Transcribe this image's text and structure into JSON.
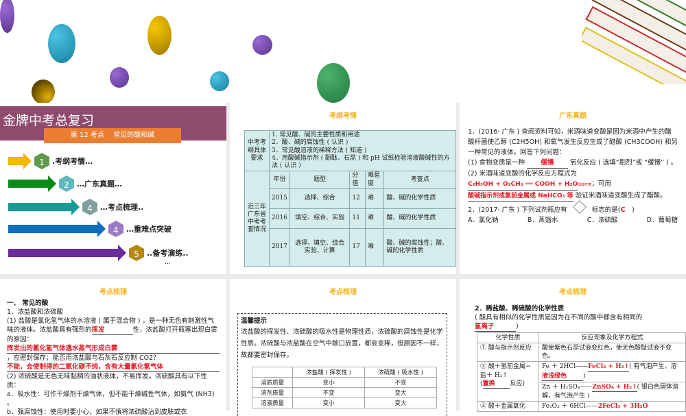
{
  "colors": {
    "banner": "#8f4b6d",
    "ribbon": "#ed7d31",
    "accent_title": "#f2b41c",
    "answer_red": "#e0202a",
    "table_bg": "#d4ecec"
  },
  "slide1": {
    "title": "金牌中考总复习",
    "ribbon": "第 12 考点　 常见的酸和碱",
    "items": [
      {
        "num": "1",
        "label": ".考纲考情…",
        "color": "#f5b800",
        "cube": "#5e9a4a"
      },
      {
        "num": "2",
        "label": "…广东真题…",
        "color": "#0a8a1a",
        "cube": "#5fb8c0"
      },
      {
        "num": "4",
        "label": "…考点梳理..",
        "color": "#139c96",
        "cube": "#7f9e9e"
      },
      {
        "num": "4",
        "label": "…重难点突破",
        "color": "#0f6fbf",
        "cube": "#9b7cc4"
      },
      {
        "num": "5",
        "label": "..备考演练..",
        "color": "#6a2c9a",
        "cube": "#b58a10"
      }
    ],
    "dots": [
      "…",
      "…",
      "…",
      "………",
      "…"
    ]
  },
  "slide2": {
    "heading": "考纲考情",
    "req_label": "中考考纲具体要求",
    "requirements": [
      "1. 常见酸、碱的主要性质和用途",
      "2．酸、碱的腐蚀性 ( 认识 )",
      "3．常见酸溶液的稀释方法 ( 知道 )",
      "4．用酸碱指示剂 ( 酚酞、石蕊 ) 和 pH 试纸检验溶液酸碱性的方法 ( 认识 )"
    ],
    "history_label": "近三年广东省中考考查情况",
    "headers": [
      "年份",
      "题型",
      "分值",
      "难易度",
      "考查点"
    ],
    "rows": [
      [
        "2015",
        "选择、综合",
        "12",
        "难",
        "酸、碱的化学性质"
      ],
      [
        "2016",
        "填空、综合、实验",
        "11",
        "难",
        "酸、碱的化学性质"
      ],
      [
        "2017",
        "选择、填空、综合实验、计算",
        "17",
        "难",
        "酸、碱的腐蚀性；酸、碱的化学性质"
      ]
    ]
  },
  "slide3": {
    "heading": "广东真题",
    "q1_intro": "1．(2016· 广东 ) 查阅资料可知，米酒味道变酸是因为米酒中产生的醋酸杆菌使乙醇 (C2H5OH) 和氧气发生反应生成了醋酸 (CH3COOH) 和另一种常见的液体。回答下列问题：",
    "q1_1a": "(1) 食物变质是一种",
    "q1_1ans": "缓慢",
    "q1_1b": "氧化反应 ( 选填“剧烈”或 “缓慢” ) 。",
    "q1_2a": "(2) 米酒味道变酸的化学反应方程式为",
    "q1_2ans": "C₂H₅OH + O₂CH₃ ══ COOH + H₂O",
    "q1_2cond": "醋酸杆菌",
    "q1_2b": "；可用",
    "q1_3ans": "酸碱指示剂或氢前金属或 NaHCO₃ 等",
    "q1_3b": "验证米酒味道变酸生成了醋酸。",
    "q2": "2．(2017· 广东 ) 下列试剂瓶应有",
    "q2b": "标志的是(",
    "q2ans": "C",
    "q2c": ")",
    "options": [
      "A．氯化钠",
      "B．蒸馏水",
      "C．浓硫酸",
      "D．葡萄糖"
    ]
  },
  "slide4": {
    "heading": "考点梳理",
    "h1": "一、 常见的酸",
    "h2": "1．浓盐酸和浓硫酸",
    "p1": "(1) 盐酸是氯化氢气体的水溶液 ( 属于混合物 ) ，是一种无色有刺激性气味的液体。浓盐酸具有强烈的",
    "a1": "挥发",
    "p1b": "性，浓盐酸打开瓶塞出现白雾的原因：",
    "a2": "挥发出的氯化氢气体遇水蒸气形成白雾",
    "p2": "，应密封保存；能否用浓盐酸与石灰石反应制 CO2？",
    "a3": "不能，会使制得的二氧化碳不纯，含有大量氯化氢气体",
    "p3": "(2) 浓硫酸是无色无味黏稠的油状液体，不易挥发。浓硫酸具有以下性质：",
    "p4": "a．吸水性：可作干燥剂干燥气体，但不能干燥碱性气体，如氨气 (NH3) 。",
    "p5": "b．强腐蚀性：使用时要小心，如果不慎将浓硫酸沾到皮肤或衣"
  },
  "slide5": {
    "heading": "考点梳理",
    "tip_title": "温馨提示",
    "tip_text": "浓盐酸的挥发性、浓硫酸的吸水性是物理性质，浓硫酸的腐蚀性是化学性质。浓硫酸与浓盐酸在空气中敞口放置，都会变稀，但原因不一样，故都要密封保存。",
    "headers": [
      "",
      "浓盐酸 ( 挥发性 )",
      "浓硫酸 ( 吸水性 )"
    ],
    "rows": [
      [
        "溶质质量",
        "变小",
        "不变"
      ],
      [
        "溶剂质量",
        "不变",
        "变大"
      ],
      [
        "溶液质量",
        "变小",
        "变大"
      ]
    ]
  },
  "slide6": {
    "heading": "考点梳理",
    "h1": "2．稀盐酸、稀硫酸的化学性质",
    "intro": "( 酸具有相似的化学性质是因为在不同的酸中都含有相同的",
    "intro_ans": "氢离子",
    "intro_end": ")",
    "headers": [
      "化学性质",
      "反应现象及化学方程式"
    ],
    "r1": [
      "① 酸与指示剂反应",
      "酸使紫色石蕊试液变红色，使无色酚酞试液不变色。"
    ],
    "r2_label": "② 酸＋氢前金属→盐＋ H₂↑",
    "r2_type_a": "(",
    "r2_type_ans": "置换",
    "r2_type_b": "反应)",
    "r2a_pre": "Fe ＋ 2HCl——",
    "r2a_ans": "FeCl₂ + H₂↑",
    "r2a_post": "( 有气泡产生，溶",
    "r2a_ans2": "液浅绿色",
    "r2a_end": ")",
    "r2b_pre": "Zn ＋ H₂SO₄——",
    "r2b_ans": "ZnSO₄ + H₂↑",
    "r2b_post": "( 银白色固体溶解，有气泡产生 )",
    "r3_label": "③ 酸＋金属氧化",
    "r3_pre": "Fe₂O₃ ＋ 6HCl——",
    "r3_ans": "2FeCl₃ + 3H₂O"
  }
}
